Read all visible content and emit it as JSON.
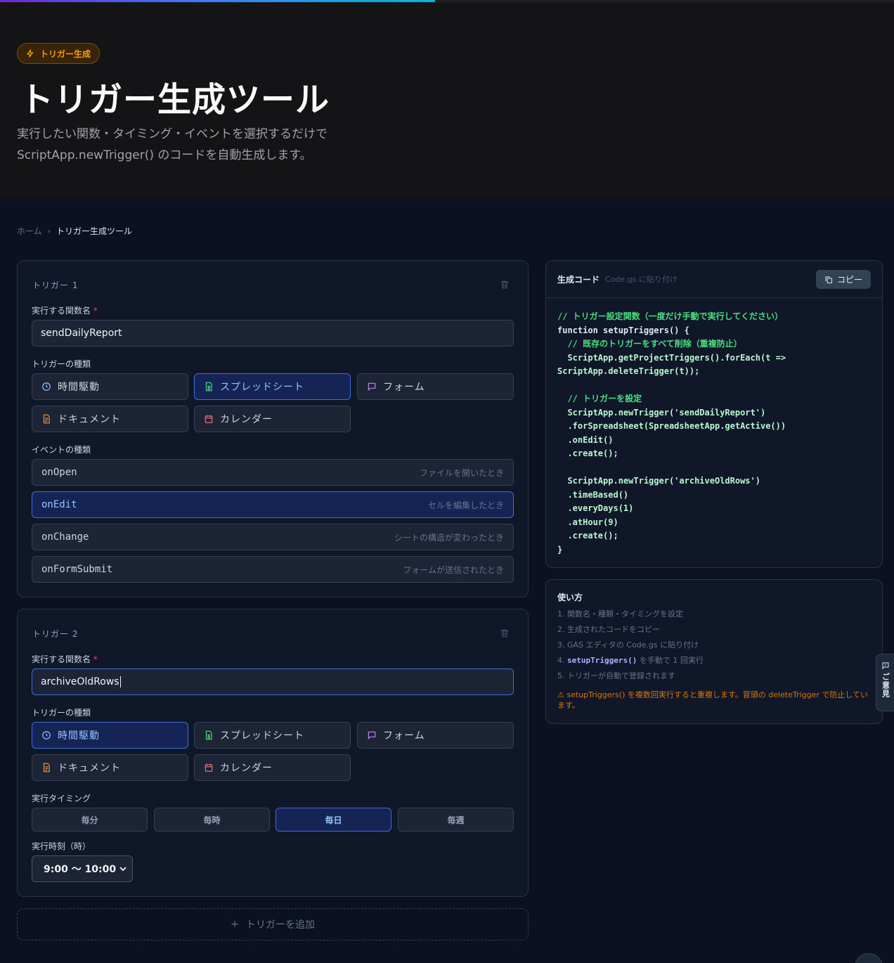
{
  "colors": {
    "accent": "#3b6fd4",
    "badge": "#f59e0b",
    "warn": "#d97706",
    "bg": "#0b1120"
  },
  "progress": 0.487,
  "hero": {
    "badge": "トリガー生成",
    "badge_icon": "lightning-icon",
    "title": "トリガー生成ツール",
    "subtitle_line1": "実行したい関数・タイミング・イベントを選択するだけで",
    "subtitle_line2": "ScriptApp.newTrigger() のコードを自動生成します。"
  },
  "breadcrumb": {
    "home": "ホーム",
    "separator": "›",
    "current": "トリガー生成ツール"
  },
  "trigger1": {
    "heading": "トリガー 1",
    "function_label": "実行する関数名",
    "required_mark": "*",
    "function_value": "sendDailyReport",
    "type_label": "トリガーの種類",
    "types": [
      "時間駆動",
      "スプレッドシート",
      "フォーム",
      "ドキュメント",
      "カレンダー"
    ],
    "selected_type": "スプレッドシート",
    "event_label": "イベントの種類",
    "events": [
      {
        "name": "onOpen",
        "desc": "ファイルを開いたとき"
      },
      {
        "name": "onEdit",
        "desc": "セルを編集したとき"
      },
      {
        "name": "onChange",
        "desc": "シートの構造が変わったとき"
      },
      {
        "name": "onFormSubmit",
        "desc": "フォームが送信されたとき"
      }
    ],
    "selected_event": "onEdit"
  },
  "trigger2": {
    "heading": "トリガー 2",
    "function_label": "実行する関数名",
    "required_mark": "*",
    "function_value": "archiveOldRows",
    "type_label": "トリガーの種類",
    "types": [
      "時間駆動",
      "スプレッドシート",
      "フォーム",
      "ドキュメント",
      "カレンダー"
    ],
    "selected_type": "時間駆動",
    "timing_label": "実行タイミング",
    "timings": [
      "毎分",
      "毎時",
      "毎日",
      "毎週"
    ],
    "selected_timing": "毎日",
    "hour_label": "実行時刻（時）",
    "hour_value": "9:00 〜 10:00"
  },
  "add_trigger": {
    "icon": "+",
    "label": "トリガーを追加"
  },
  "code_panel": {
    "title": "生成コード",
    "hint": "Code.gs に貼り付け",
    "copy_label": "コピー",
    "lines": [
      "// トリガー設定関数（一度だけ手動で実行してください）",
      "function setupTriggers() {",
      "  // 既存のトリガーをすべて削除（重複防止）",
      "  ScriptApp.getProjectTriggers().forEach(t =>",
      "ScriptApp.deleteTrigger(t));",
      "",
      "  // トリガーを設定",
      "  ScriptApp.newTrigger('sendDailyReport')",
      "  .forSpreadsheet(SpreadsheetApp.getActive())",
      "  .onEdit()",
      "  .create();",
      "",
      "  ScriptApp.newTrigger('archiveOldRows')",
      "  .timeBased()",
      "  .everyDays(1)",
      "  .atHour(9)",
      "  .create();",
      "}"
    ]
  },
  "howto": {
    "title": "使い方",
    "steps": [
      "1. 関数名・種類・タイミングを設定",
      "2. 生成されたコードをコピー",
      "3. GAS エディタの Code.gs に貼り付け",
      "5. トリガーが自動で登録されます"
    ],
    "step4_prefix": "4. ",
    "step4_code": "setupTriggers()",
    "step4_suffix": " を手動で 1 回実行",
    "warning": "⚠ setupTriggers() を複数回実行すると重複します。冒頭の deleteTrigger で防止しています。"
  },
  "feedback": {
    "label": "ご意見"
  }
}
